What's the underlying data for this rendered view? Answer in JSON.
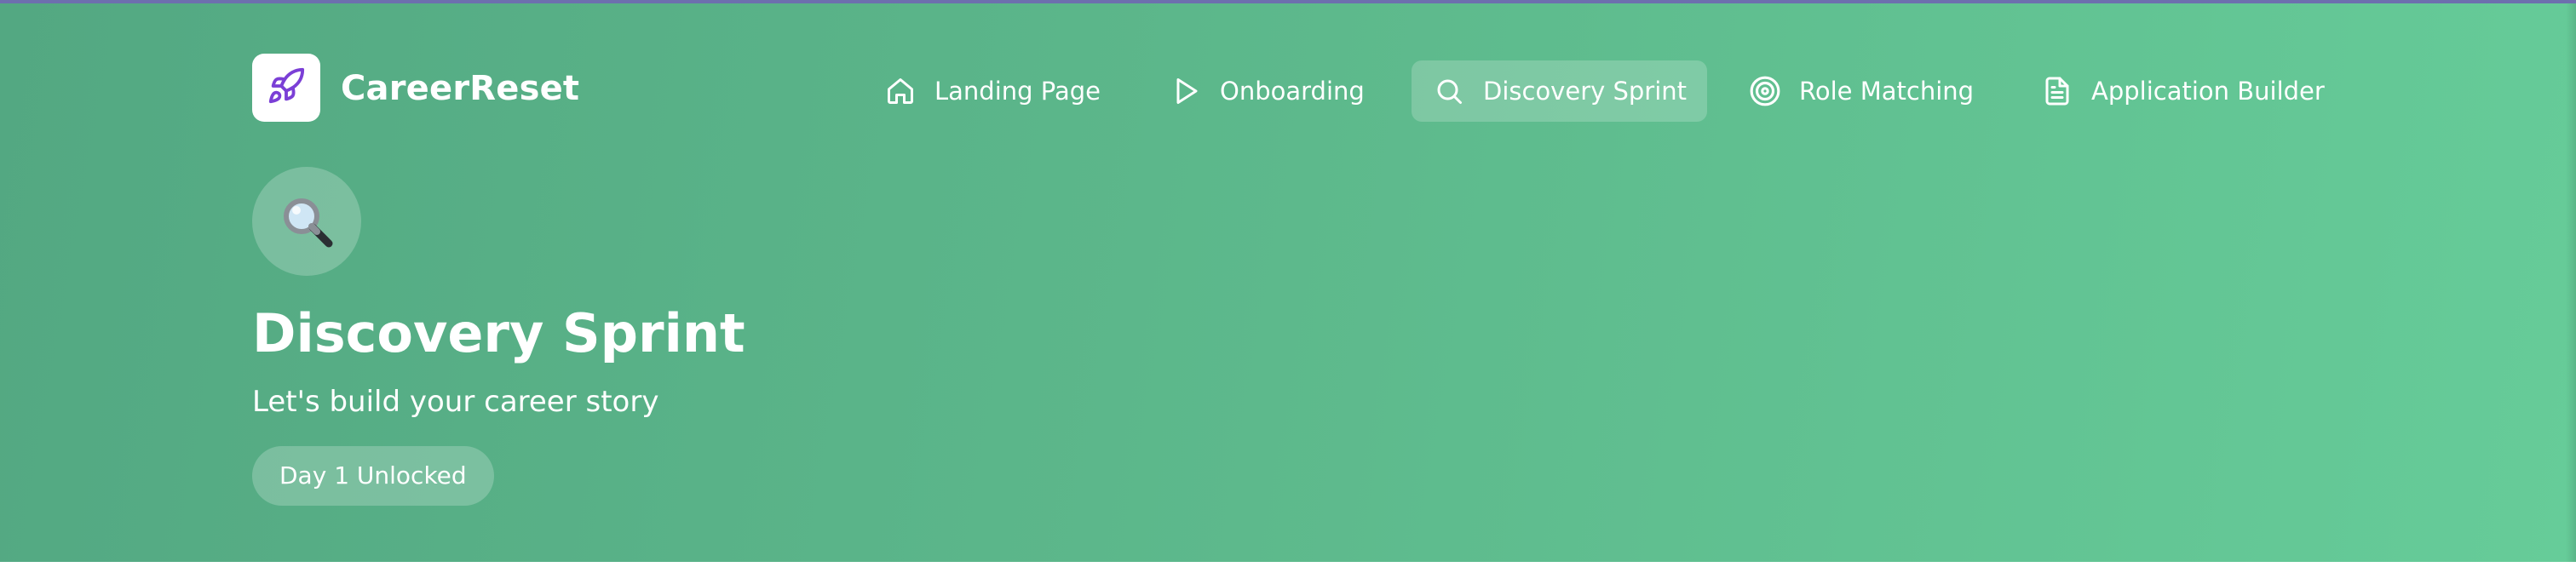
{
  "app": {
    "brand_name": "CareerReset",
    "logo_icon": "rocket-icon",
    "accent_color": "#7b3fd6"
  },
  "nav": {
    "items": [
      {
        "label": "Landing Page",
        "icon": "home-icon",
        "active": false
      },
      {
        "label": "Onboarding",
        "icon": "play-icon",
        "active": false
      },
      {
        "label": "Discovery Sprint",
        "icon": "search-icon",
        "active": true
      },
      {
        "label": "Role Matching",
        "icon": "target-icon",
        "active": false
      },
      {
        "label": "Application Builder",
        "icon": "document-icon",
        "active": false
      }
    ]
  },
  "hero": {
    "icon": "magnifying-glass-emoji",
    "title": "Discovery Sprint",
    "subtitle": "Let's build your career story",
    "badge": "Day 1 Unlocked",
    "gradient_start": "#53a882",
    "gradient_end": "#66cc99"
  }
}
